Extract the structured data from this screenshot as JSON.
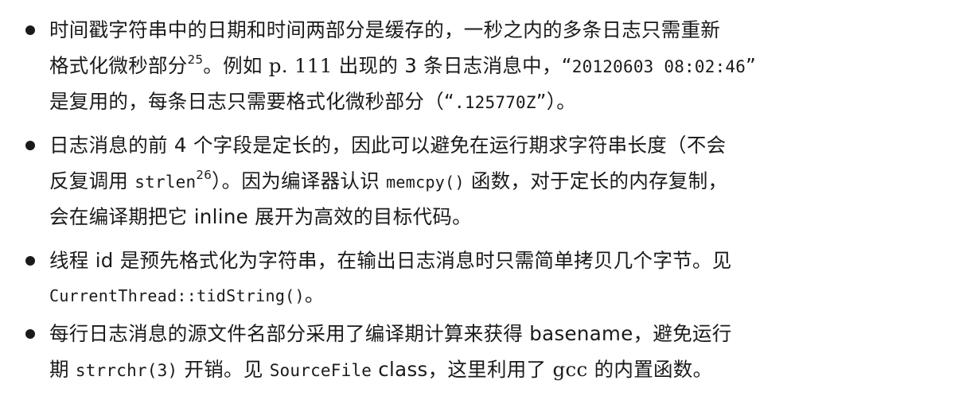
{
  "items": [
    {
      "lines": [
        {
          "segments": [
            "时间戳字符串中的日期和时间两部分是缓存的，一秒之内的多条日志只需重新"
          ]
        },
        {
          "segments": [
            "格式化微秒部分",
            "25",
            "。例如 ",
            "p. 111",
            " 出现的 3 条日志消息中，“",
            "20120603 08:02:46",
            "”"
          ]
        },
        {
          "segments": [
            "是复用的，每条日志只需要格式化微秒部分（“",
            ".125770Z",
            "”）。"
          ]
        }
      ]
    },
    {
      "lines": [
        {
          "segments": [
            "日志消息的前 4 个字段是定长的，因此可以避免在运行期求字符串长度（不会"
          ]
        },
        {
          "segments": [
            "反复调用 ",
            "strlen",
            "26",
            "）。因为编译器认识 ",
            "memcpy()",
            " 函数，对于定长的内存复制，"
          ]
        },
        {
          "segments": [
            "会在编译期把它 ",
            "inline",
            " 展开为高效的目标代码。"
          ]
        }
      ]
    },
    {
      "lines": [
        {
          "segments": [
            "线程 ",
            "id",
            " 是预先格式化为字符串，在输出日志消息时只需简单拷贝几个字节。见"
          ]
        },
        {
          "segments": [
            "CurrentThread::tidString()",
            "。"
          ]
        }
      ]
    },
    {
      "lines": [
        {
          "segments": [
            "每行日志消息的源文件名部分采用了编译期计算来获得 ",
            "basename",
            "，避免运行"
          ]
        },
        {
          "segments": [
            "期 ",
            "strrchr(3)",
            " 开销。见 ",
            "SourceFile",
            " ",
            "class",
            "，这里利用了 ",
            "gcc",
            " 的内置函数。"
          ]
        }
      ]
    }
  ]
}
